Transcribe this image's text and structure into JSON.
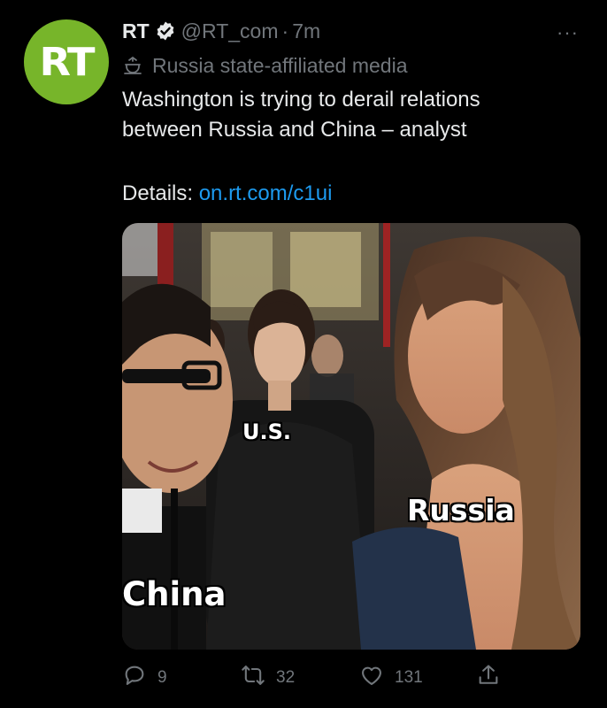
{
  "account": {
    "avatar_text": "RT",
    "display_name": "RT",
    "handle": "@RT_com",
    "separator": "·",
    "time": "7m",
    "more": "···",
    "label": "Russia state-affiliated media"
  },
  "tweet": {
    "text_lines": [
      "Washington is trying to derail relations",
      "between Russia and China – analyst"
    ],
    "details_prefix": "Details:",
    "link_text": "on.rt.com/c1ui"
  },
  "media": {
    "captions": {
      "us": "U.S.",
      "russia": "Russia",
      "china": "China"
    }
  },
  "actions": {
    "reply_count": "9",
    "retweet_count": "32",
    "like_count": "131"
  },
  "colors": {
    "background": "#000000",
    "avatar": "#77b52a",
    "link": "#1d9bf0",
    "muted": "#71767b"
  }
}
